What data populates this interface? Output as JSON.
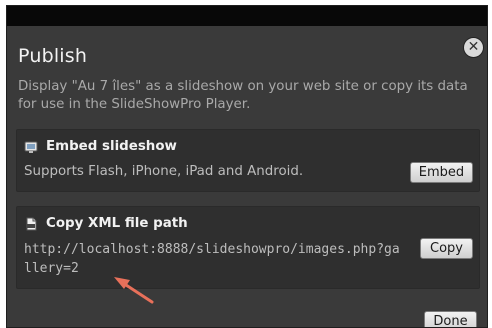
{
  "dialog": {
    "title": "Publish",
    "description": "Display \"Au 7 îles\" as a slideshow on your web site or copy its data for use in the SlideShowPro Player.",
    "close_icon": "close-icon"
  },
  "embed": {
    "icon": "slideshow-icon",
    "title": "Embed slideshow",
    "subtitle": "Supports Flash, iPhone, iPad and Android.",
    "button_label": "Embed"
  },
  "xml": {
    "icon": "xml-file-icon",
    "title": "Copy XML file path",
    "path": "http://localhost:8888/slideshowpro/images.php?gallery=2",
    "button_label": "Copy"
  },
  "footer": {
    "done_label": "Done"
  },
  "annotation": {
    "arrow_color": "#e8705a"
  }
}
